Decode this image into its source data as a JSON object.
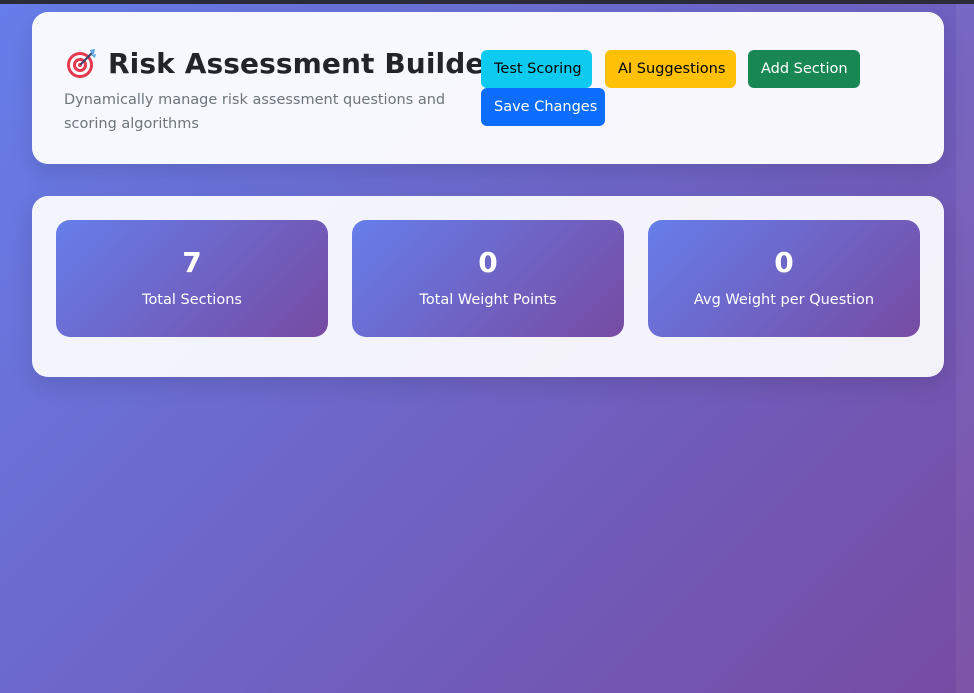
{
  "header": {
    "icon": "target-icon",
    "title": "Risk Assessment Builder",
    "subtitle": "Dynamically manage risk assessment questions and scoring algorithms"
  },
  "actions": {
    "test_scoring": "Test Scoring",
    "ai_suggestions": "AI Suggestions",
    "add_section": "Add Section",
    "save_changes": "Save Changes"
  },
  "stats": [
    {
      "value": "7",
      "label": "Total Sections"
    },
    {
      "value": "0",
      "label": "Total Weight Points"
    },
    {
      "value": "0",
      "label": "Avg Weight per Question"
    }
  ],
  "colors": {
    "gradient_start": "#667eea",
    "gradient_end": "#764ba2",
    "info": "#0dcaf0",
    "warning": "#ffc107",
    "success": "#198754",
    "primary": "#0d6efd"
  }
}
